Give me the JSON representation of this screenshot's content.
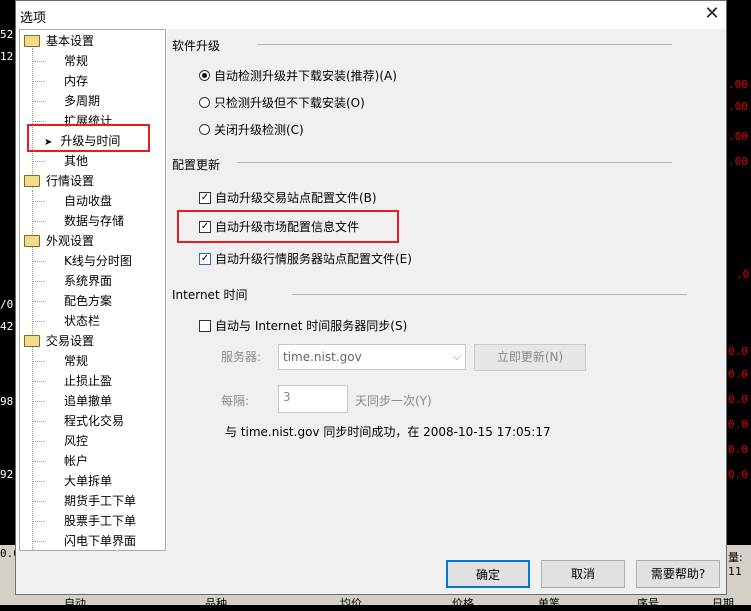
{
  "dialog": {
    "title": "选项",
    "close_glyph": "✕"
  },
  "tree": {
    "items": [
      {
        "label": "基本设置",
        "level": 0
      },
      {
        "label": "常规",
        "level": 1
      },
      {
        "label": "内存",
        "level": 1
      },
      {
        "label": "多周期",
        "level": 1
      },
      {
        "label": "扩展统计",
        "level": 1
      },
      {
        "label": "升级与时间",
        "level": 1,
        "selected": true
      },
      {
        "label": "其他",
        "level": 1
      },
      {
        "label": "行情设置",
        "level": 0
      },
      {
        "label": "自动收盘",
        "level": 1
      },
      {
        "label": "数据与存储",
        "level": 1
      },
      {
        "label": "外观设置",
        "level": 0
      },
      {
        "label": "K线与分时图",
        "level": 1
      },
      {
        "label": "系统界面",
        "level": 1
      },
      {
        "label": "配色方案",
        "level": 1
      },
      {
        "label": "状态栏",
        "level": 1
      },
      {
        "label": "交易设置",
        "level": 0
      },
      {
        "label": "常规",
        "level": 1
      },
      {
        "label": "止损止盈",
        "level": 1
      },
      {
        "label": "追单撤单",
        "level": 1
      },
      {
        "label": "程式化交易",
        "level": 1
      },
      {
        "label": "风控",
        "level": 1
      },
      {
        "label": "帐户",
        "level": 1
      },
      {
        "label": "大单拆单",
        "level": 1
      },
      {
        "label": "期货手工下单",
        "level": 1
      },
      {
        "label": "股票手工下单",
        "level": 1
      },
      {
        "label": "闪电下单界面",
        "level": 1
      }
    ]
  },
  "upgrade": {
    "section_label": "软件升级",
    "auto_download": "自动检测升级并下载安装(推荐)(A)",
    "check_only": "只检测升级但不下载安装(O)",
    "disable": "关闭升级检测(C)"
  },
  "config": {
    "section_label": "配置更新",
    "trade_station": "自动升级交易站点配置文件(B)",
    "market_info": "自动升级市场配置信息文件",
    "quote_server": "自动升级行情服务器站点配置文件(E)"
  },
  "internet": {
    "section_label": "Internet 时间",
    "sync_label": "自动与 Internet 时间服务器同步(S)",
    "server_label": "服务器:",
    "server_value": "time.nist.gov",
    "update_now": "立即更新(N)",
    "interval_label": "每隔:",
    "interval_value": "3",
    "interval_unit": "天同步一次(Y)",
    "status": "与 time.nist.gov 同步时间成功，在 2008-10-15 17:05:17"
  },
  "footer": {
    "ok": "确定",
    "cancel": "取消",
    "help": "需要帮助?"
  },
  "background": {
    "left_numbers": [
      "52",
      "12",
      "/0",
      "42",
      "98",
      "92",
      "0.0"
    ],
    "right_numbers": [
      ".00",
      ".00",
      ".00",
      ".00",
      ".0",
      "0.0",
      "0.0",
      "0.0",
      "0.0",
      "0.0",
      "0.0"
    ],
    "bottom_texts": [
      "自动",
      "品种",
      "均价",
      "价格",
      "单笔",
      "序号",
      "日期"
    ],
    "bottom_right": "量: 11"
  },
  "colors": {
    "highlight": "#e02020",
    "checkbox_blue": "#2b6cb6",
    "panel_bg": "#f0f0f0"
  }
}
